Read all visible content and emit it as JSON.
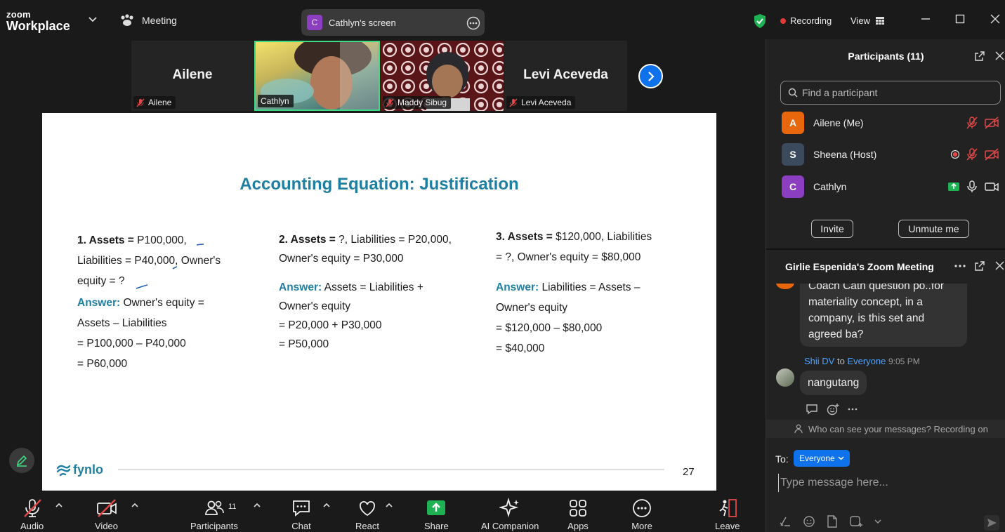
{
  "titlebar": {
    "brand_line1": "zoom",
    "brand_line2": "Workplace",
    "meeting_label": "Meeting",
    "screen_share_initial": "C",
    "screen_share_label": "Cathlyn's screen",
    "recording_label": "Recording",
    "view_label": "View"
  },
  "video_strip": {
    "tiles": [
      {
        "name": "Ailene",
        "big_name": "Ailene"
      },
      {
        "name": "Cathlyn"
      },
      {
        "name": "Maddy Sibug"
      },
      {
        "name": "Levi Aceveda",
        "big_name": "Levi Aceveda"
      }
    ]
  },
  "slide": {
    "title": "Accounting Equation: Justification",
    "col1": {
      "q_num": "1. Assets =",
      "q_rest1": " P100,000,",
      "q_line2": "Liabilities = P40,000, Owner's",
      "q_line3": "equity = ?",
      "answer_label": "Answer:",
      "answer_rest": " Owner's equity =",
      "a_line2": "Assets – Liabilities",
      "a_line3": "= P100,000 – P40,000",
      "a_line4": "= P60,000"
    },
    "col2": {
      "q_num": "2. Assets =",
      "q_rest1": " ?, Liabilities = P20,000,",
      "q_line2": "Owner's equity = P30,000",
      "answer_label": "Answer:",
      "answer_rest": " Assets = Liabilities +",
      "a_line2": "Owner's equity",
      "a_line3": "= P20,000 + P30,000",
      "a_line4": "= P50,000"
    },
    "col3": {
      "q_num": "3. Assets =",
      "q_rest1": " $120,000, Liabilities",
      "q_line2": "= ?, Owner's equity = $80,000",
      "answer_label": "Answer:",
      "answer_rest": " Liabilities = Assets –",
      "a_line2": "Owner's equity",
      "a_line3": "= $120,000 – $80,000",
      "a_line4": "= $40,000"
    },
    "logo": "fynlo",
    "page_number": "27"
  },
  "toolbar": {
    "audio": "Audio",
    "video": "Video",
    "participants": "Participants",
    "participants_count": "11",
    "chat": "Chat",
    "react": "React",
    "share": "Share",
    "ai_companion": "AI Companion",
    "apps": "Apps",
    "more": "More",
    "leave": "Leave"
  },
  "participants_panel": {
    "title": "Participants (11)",
    "search_placeholder": "Find a participant",
    "participants": [
      {
        "initial": "A",
        "name": "Ailene (Me)",
        "color": "#e8670c"
      },
      {
        "initial": "S",
        "name": "Sheena (Host)",
        "color": "#3c4a5e"
      },
      {
        "initial": "C",
        "name": "Cathlyn",
        "color": "#8b3fc0"
      }
    ],
    "invite_label": "Invite",
    "unmute_label": "Unmute me"
  },
  "chat_panel": {
    "title": "Girlie Espenida's Zoom Meeting",
    "messages": [
      {
        "text_line1": "Coach Cath question po..for",
        "text_line2": "materiality concept, in a",
        "text_line3": "company, is this set and",
        "text_line4": "agreed ba?"
      },
      {
        "sender": "Shii DV",
        "to_word": "to",
        "recipient": "Everyone",
        "time": "9:05 PM",
        "text": "nangutang"
      }
    ],
    "notice": "Who can see your messages? Recording on",
    "to_label": "To:",
    "recipient_select": "Everyone",
    "input_placeholder": "Type message here..."
  }
}
